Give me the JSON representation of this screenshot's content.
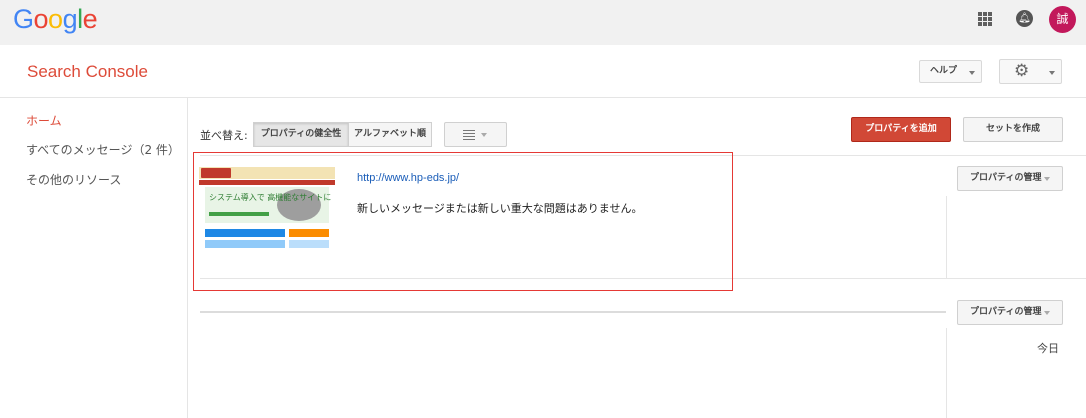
{
  "topbar": {
    "logo_letters": [
      "G",
      "o",
      "o",
      "g",
      "l",
      "e"
    ],
    "logo_colors": [
      "#4285F4",
      "#EA4335",
      "#FBBC05",
      "#4285F4",
      "#34A853",
      "#EA4335"
    ],
    "apps_icon": "apps-grid-icon",
    "notifications_icon": "bell-icon",
    "avatar_initial": "誠",
    "avatar_color": "#c2185b"
  },
  "header": {
    "brand": "Search Console",
    "help_label": "ヘルプ",
    "settings_icon": "gear-icon"
  },
  "sidebar": {
    "items": [
      {
        "label": "ホーム",
        "active": true
      },
      {
        "label": "すべてのメッセージ（2 件）",
        "active": false
      },
      {
        "label": "その他のリソース",
        "active": false
      }
    ]
  },
  "toolbar": {
    "sort_label": "並べ替え:",
    "sort_options": [
      {
        "label": "プロパティの健全性",
        "selected": true
      },
      {
        "label": "アルファベット順",
        "selected": false
      }
    ],
    "view_icon": "list-view-icon",
    "add_property_label": "プロパティを追加",
    "create_set_label": "セットを作成"
  },
  "properties": [
    {
      "url": "http://www.hp-eds.jp/",
      "message": "新しいメッセージまたは新しい重大な問題はありません。",
      "manage_label": "プロパティの管理",
      "thumbnail_text": "システム導入で 高機能なサイトに"
    }
  ],
  "second_row": {
    "manage_label": "プロパティの管理",
    "date_label": "今日"
  },
  "colors": {
    "accent_red": "#dd4b39",
    "add_button": "#d14836",
    "link_blue": "#1a5db8",
    "highlight_border": "#e53935"
  }
}
